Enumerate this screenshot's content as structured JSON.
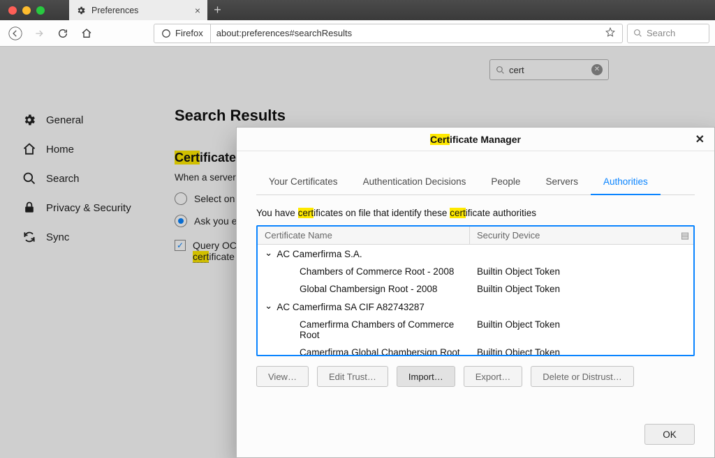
{
  "tab": {
    "title": "Preferences"
  },
  "toolbar": {
    "identity": "Firefox",
    "url": "about:preferences#searchResults",
    "search_placeholder": "Search"
  },
  "settings_search": {
    "value": "cert"
  },
  "sidebar": {
    "items": [
      {
        "label": "General"
      },
      {
        "label": "Home"
      },
      {
        "label": "Search"
      },
      {
        "label": "Privacy & Security"
      },
      {
        "label": "Sync"
      }
    ]
  },
  "main": {
    "heading": "Search Results",
    "section_title_hl": "Cert",
    "section_title_rest": "ificates",
    "subline": "When a server",
    "radio_unselected": "Select on",
    "radio_selected": "Ask you e",
    "check_line1": "Query OC",
    "check_line2_hl": "cert",
    "check_line2_rest": "ificate"
  },
  "dialog": {
    "title_hl": "Cert",
    "title_rest": "ificate Manager",
    "tabs": [
      "Your Certificates",
      "Authentication Decisions",
      "People",
      "Servers",
      "Authorities"
    ],
    "intro_pre": "You have ",
    "intro_hl1": "cert",
    "intro_mid": "ificates on file that identify these ",
    "intro_hl2": "cert",
    "intro_post": "ificate authorities",
    "columns": {
      "name": "Certificate Name",
      "device": "Security Device"
    },
    "groups": [
      {
        "name": "AC Camerfirma S.A.",
        "rows": [
          {
            "name": "Chambers of Commerce Root - 2008",
            "device": "Builtin Object Token"
          },
          {
            "name": "Global Chambersign Root - 2008",
            "device": "Builtin Object Token"
          }
        ]
      },
      {
        "name": "AC Camerfirma SA CIF A82743287",
        "rows": [
          {
            "name": "Camerfirma Chambers of Commerce Root",
            "device": "Builtin Object Token"
          },
          {
            "name": "Camerfirma Global Chambersign Root",
            "device": "Builtin Object Token"
          }
        ]
      }
    ],
    "buttons": {
      "view": "View…",
      "edit": "Edit Trust…",
      "import": "Import…",
      "export": "Export…",
      "delete": "Delete or Distrust…",
      "ok": "OK"
    }
  }
}
